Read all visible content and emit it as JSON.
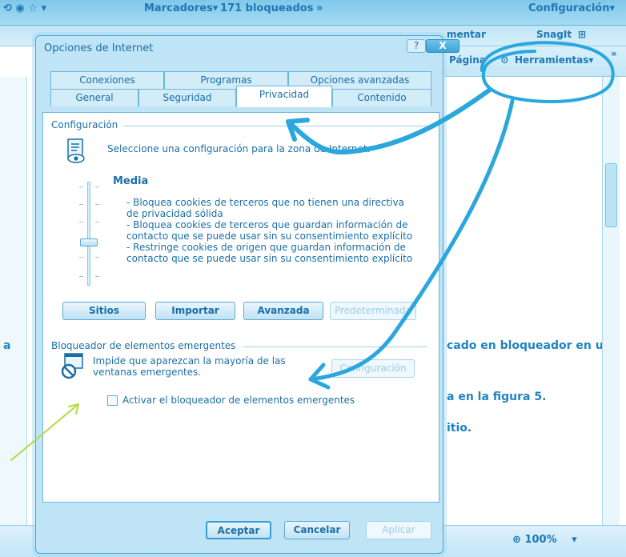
{
  "colors": {
    "accent": "#1b6fa8",
    "chrome": "#bfe4f6",
    "highlight_stroke": "#2aa7dc",
    "green_arrow": "#b5d943"
  },
  "browser": {
    "toolbar_items": [
      "Marcadores▾",
      "171 bloqueados",
      "»",
      "Configuración▾"
    ],
    "toolbar2_items": [
      "mentar",
      "SnagIt"
    ],
    "toolbar3_items": [
      "Página",
      "Herramientas▾",
      "»"
    ],
    "page_text": [
      "a",
      "cado en bloqueador en una",
      "a en la figura 5.",
      "itio."
    ],
    "zoom": "100%"
  },
  "dialog": {
    "title": "Opciones de Internet",
    "help_label": "?",
    "close_label": "X",
    "tabs_row1": [
      "Conexiones",
      "Programas",
      "Opciones avanzadas"
    ],
    "tabs_row2": [
      "General",
      "Seguridad",
      "Privacidad",
      "Contenido"
    ],
    "config": {
      "group_label": "Configuración",
      "prompt": "Seleccione una configuración para la zona de Internet.",
      "level_title": "Media",
      "level_description": [
        "- Bloquea cookies de terceros que no tienen una directiva",
        "de privacidad sólida",
        "- Bloquea cookies de terceros que guardan información de",
        "contacto que se puede usar sin su consentimiento explícito",
        "- Restringe cookies de origen que guardan información de",
        "contacto que se  puede usar sin su consentimiento explícito"
      ],
      "slider_level": 0.5,
      "buttons": {
        "sites": "Sitios",
        "import": "Importar",
        "advanced": "Avanzada",
        "default": "Predeterminada"
      }
    },
    "popup": {
      "group_label": "Bloqueador de elementos emergentes",
      "description": [
        "Impide que aparezcan la mayoría de las",
        "ventanas emergentes."
      ],
      "settings_button": "Configuración",
      "checkbox_label": "Activar el bloqueador de elementos emergentes",
      "checkbox_checked": false
    },
    "footer": {
      "accept": "Aceptar",
      "cancel": "Cancelar",
      "apply": "Aplicar"
    }
  }
}
